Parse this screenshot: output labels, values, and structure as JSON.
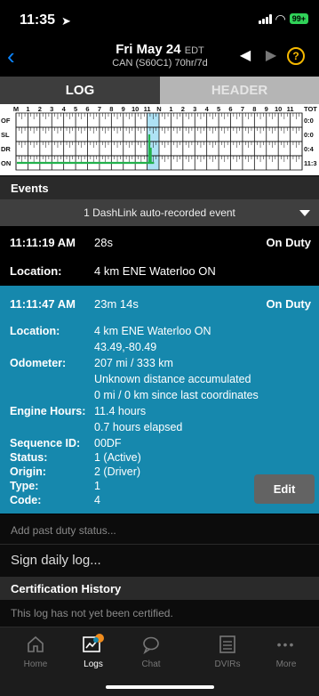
{
  "status_bar": {
    "time": "11:35",
    "battery": "99+"
  },
  "header": {
    "date": "Fri May 24",
    "timezone": "EDT",
    "ruleset": "CAN (S60C1) 70hr/7d",
    "back_icon": "chevron-left-icon",
    "help_icon": "question-circle-icon"
  },
  "tabs": {
    "log": "LOG",
    "header": "HEADER"
  },
  "grid": {
    "rows": [
      "OF",
      "SL",
      "DR",
      "ON"
    ],
    "hour_labels": [
      "M",
      "1",
      "2",
      "3",
      "4",
      "5",
      "6",
      "7",
      "8",
      "9",
      "10",
      "11",
      "N",
      "1",
      "2",
      "3",
      "4",
      "5",
      "6",
      "7",
      "8",
      "9",
      "10",
      "11"
    ],
    "total_header": "TOT",
    "totals": [
      "0:0",
      "0:0",
      "0:4",
      "11:3"
    ],
    "line_color": "#22b14c",
    "highlight_color": "#aee2f5"
  },
  "events": {
    "header": "Events",
    "banner": "1 DashLink auto-recorded event",
    "items": [
      {
        "time": "11:11:19 AM",
        "duration": "28s",
        "status": "On Duty",
        "location_label": "Location:",
        "location": "4 km ENE Waterloo ON"
      },
      {
        "time": "11:11:47 AM",
        "duration": "23m 14s",
        "status": "On Duty",
        "details": [
          {
            "label": "Location:",
            "lines": [
              "4 km ENE Waterloo ON",
              "43.49,-80.49"
            ]
          },
          {
            "label": "Odometer:",
            "lines": [
              "207 mi / 333 km",
              "Unknown distance accumulated",
              "0 mi / 0 km since last coordinates"
            ]
          },
          {
            "label": "Engine Hours:",
            "lines": [
              "11.4 hours",
              "0.7 hours elapsed"
            ]
          },
          {
            "label": "Sequence ID:",
            "lines": [
              "00DF"
            ]
          },
          {
            "label": "Status:",
            "lines": [
              "1 (Active)"
            ]
          },
          {
            "label": "Origin:",
            "lines": [
              "2 (Driver)"
            ]
          },
          {
            "label": "Type:",
            "lines": [
              "1"
            ]
          },
          {
            "label": "Code:",
            "lines": [
              "4"
            ]
          }
        ],
        "edit_label": "Edit"
      }
    ]
  },
  "add_past": "Add past duty status...",
  "sign_log": "Sign daily log...",
  "certification": {
    "header": "Certification History",
    "text": "This log has not yet been certified."
  },
  "tabbar": [
    {
      "label": "Home",
      "icon": "home-icon"
    },
    {
      "label": "Logs",
      "icon": "logs-icon"
    },
    {
      "label": "Chat",
      "icon": "chat-icon"
    },
    {
      "label": "DVIRs",
      "icon": "dvir-icon"
    },
    {
      "label": "More",
      "icon": "more-icon"
    }
  ]
}
